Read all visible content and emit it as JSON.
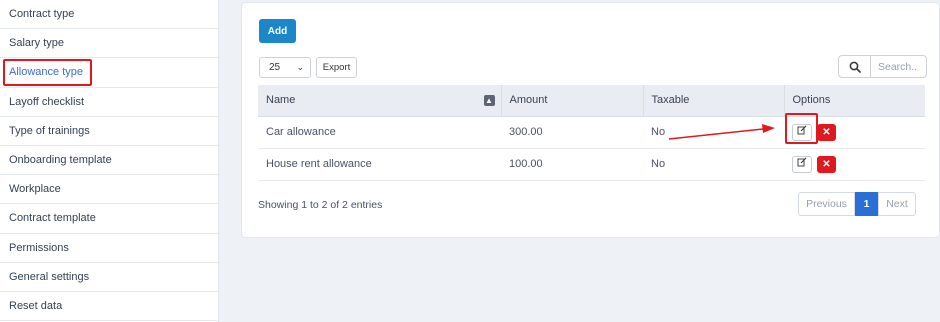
{
  "sidebar": {
    "items": [
      {
        "label": "Contract type"
      },
      {
        "label": "Salary type"
      },
      {
        "label": "Allowance type"
      },
      {
        "label": "Layoff checklist"
      },
      {
        "label": "Type of trainings"
      },
      {
        "label": "Onboarding template"
      },
      {
        "label": "Workplace"
      },
      {
        "label": "Contract template"
      },
      {
        "label": "Permissions"
      },
      {
        "label": "General settings"
      },
      {
        "label": "Reset data"
      }
    ]
  },
  "toolbar": {
    "add_label": "Add",
    "page_length": "25",
    "export_label": "Export",
    "search_placeholder": "Search.."
  },
  "table": {
    "columns": [
      "Name",
      "Amount",
      "Taxable",
      "Options"
    ],
    "rows": [
      {
        "name": "Car allowance",
        "amount": "300.00",
        "taxable": "No"
      },
      {
        "name": "House rent allowance",
        "amount": "100.00",
        "taxable": "No"
      }
    ]
  },
  "footer": {
    "info": "Showing 1 to 2 of 2 entries",
    "prev_label": "Previous",
    "current_page": "1",
    "next_label": "Next"
  },
  "colors": {
    "accent": "#1b87c9",
    "highlight": "#e0191f",
    "page_active": "#2a6fd6",
    "active_link": "#3d6bd6"
  }
}
